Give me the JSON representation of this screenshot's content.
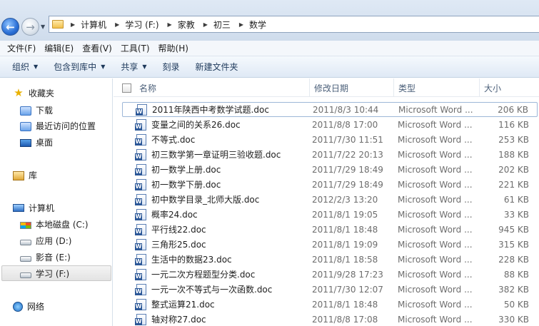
{
  "address": {
    "crumbs": [
      "计算机",
      "学习 (F:)",
      "家教",
      "初三",
      "数学"
    ]
  },
  "menu": [
    "文件(F)",
    "编辑(E)",
    "查看(V)",
    "工具(T)",
    "帮助(H)"
  ],
  "commands": [
    {
      "label": "组织",
      "has_dropdown": true
    },
    {
      "label": "包含到库中",
      "has_dropdown": true
    },
    {
      "label": "共享",
      "has_dropdown": true
    },
    {
      "label": "刻录",
      "has_dropdown": false
    },
    {
      "label": "新建文件夹",
      "has_dropdown": false
    }
  ],
  "nav": {
    "favorites": "收藏夹",
    "downloads": "下载",
    "recent": "最近访问的位置",
    "desktop": "桌面",
    "libraries": "库",
    "computer": "计算机",
    "drives": [
      "本地磁盘 (C:)",
      "应用 (D:)",
      "影音 (E:)",
      "学习 (F:)"
    ],
    "selected_drive": "学习 (F:)",
    "network": "网络"
  },
  "columns": {
    "name": "名称",
    "date": "修改日期",
    "type": "类型",
    "size": "大小"
  },
  "files": [
    {
      "name": "2011年陕西中考数学试题.doc",
      "date": "2011/8/3 10:44",
      "type": "Microsoft Word ...",
      "size": "206 KB"
    },
    {
      "name": "变量之间的关系26.doc",
      "date": "2011/8/8 17:00",
      "type": "Microsoft Word ...",
      "size": "116 KB"
    },
    {
      "name": "不等式.doc",
      "date": "2011/7/30 11:51",
      "type": "Microsoft Word ...",
      "size": "253 KB"
    },
    {
      "name": "初三数学第一章证明三验收题.doc",
      "date": "2011/7/22 20:13",
      "type": "Microsoft Word ...",
      "size": "188 KB"
    },
    {
      "name": "初一数学上册.doc",
      "date": "2011/7/29 18:49",
      "type": "Microsoft Word ...",
      "size": "202 KB"
    },
    {
      "name": "初一数学下册.doc",
      "date": "2011/7/29 18:49",
      "type": "Microsoft Word ...",
      "size": "221 KB"
    },
    {
      "name": "初中数学目录_北师大版.doc",
      "date": "2012/2/3 13:20",
      "type": "Microsoft Word ...",
      "size": "61 KB"
    },
    {
      "name": "概率24.doc",
      "date": "2011/8/1 19:05",
      "type": "Microsoft Word ...",
      "size": "33 KB"
    },
    {
      "name": "平行线22.doc",
      "date": "2011/8/1 18:48",
      "type": "Microsoft Word ...",
      "size": "945 KB"
    },
    {
      "name": "三角形25.doc",
      "date": "2011/8/1 19:09",
      "type": "Microsoft Word ...",
      "size": "315 KB"
    },
    {
      "name": "生活中的数据23.doc",
      "date": "2011/8/1 18:58",
      "type": "Microsoft Word ...",
      "size": "228 KB"
    },
    {
      "name": "一元二次方程题型分类.doc",
      "date": "2011/9/28 17:23",
      "type": "Microsoft Word ...",
      "size": "88 KB"
    },
    {
      "name": "一元一次不等式与一次函数.doc",
      "date": "2011/7/30 12:07",
      "type": "Microsoft Word ...",
      "size": "382 KB"
    },
    {
      "name": "整式运算21.doc",
      "date": "2011/8/1 18:48",
      "type": "Microsoft Word ...",
      "size": "50 KB"
    },
    {
      "name": "轴对称27.doc",
      "date": "2011/8/8 17:08",
      "type": "Microsoft Word ...",
      "size": "330 KB"
    }
  ]
}
